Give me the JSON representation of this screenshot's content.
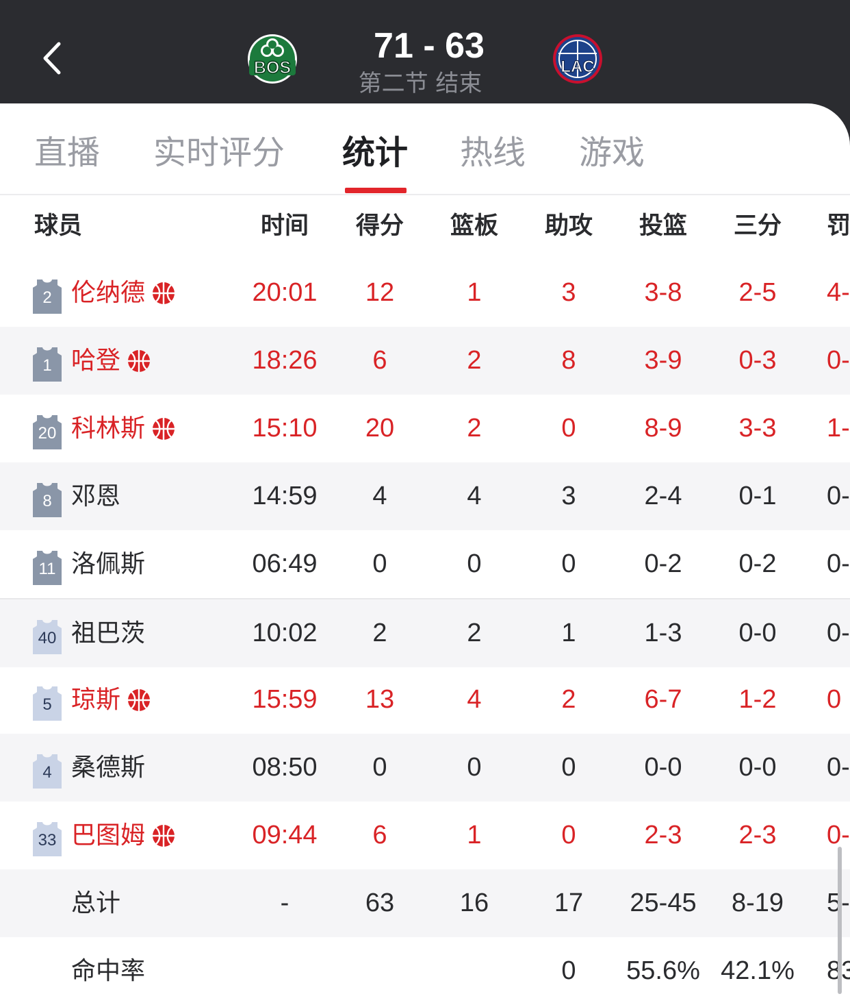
{
  "header": {
    "back_icon": "chevron-left-icon",
    "score": "71 - 63",
    "period": "第二节 结束",
    "home_team": {
      "abbr": "BOS",
      "logo": "bos-logo"
    },
    "away_team": {
      "abbr": "LAC",
      "logo": "lac-logo"
    }
  },
  "tabs": [
    {
      "label": "直播",
      "active": false
    },
    {
      "label": "实时评分",
      "active": false
    },
    {
      "label": "统计",
      "active": true
    },
    {
      "label": "热线",
      "active": false
    },
    {
      "label": "游戏",
      "active": false
    }
  ],
  "table": {
    "columns": [
      "球员",
      "时间",
      "得分",
      "篮板",
      "助攻",
      "投篮",
      "三分",
      "罚"
    ],
    "rows": [
      {
        "number": "2",
        "name": "伦纳德",
        "highlight": true,
        "jersey_style": "dark",
        "cells": [
          "20:01",
          "12",
          "1",
          "3",
          "3-8",
          "2-5",
          "4-"
        ]
      },
      {
        "number": "1",
        "name": "哈登",
        "highlight": true,
        "jersey_style": "dark",
        "cells": [
          "18:26",
          "6",
          "2",
          "8",
          "3-9",
          "0-3",
          "0-"
        ]
      },
      {
        "number": "20",
        "name": "科林斯",
        "highlight": true,
        "jersey_style": "dark",
        "cells": [
          "15:10",
          "20",
          "2",
          "0",
          "8-9",
          "3-3",
          "1-"
        ]
      },
      {
        "number": "8",
        "name": "邓恩",
        "highlight": false,
        "jersey_style": "dark",
        "cells": [
          "14:59",
          "4",
          "4",
          "3",
          "2-4",
          "0-1",
          "0-"
        ]
      },
      {
        "number": "11",
        "name": "洛佩斯",
        "highlight": false,
        "jersey_style": "dark",
        "cells": [
          "06:49",
          "0",
          "0",
          "0",
          "0-2",
          "0-2",
          "0-"
        ]
      },
      {
        "number": "40",
        "name": "祖巴茨",
        "highlight": false,
        "jersey_style": "light",
        "cells": [
          "10:02",
          "2",
          "2",
          "1",
          "1-3",
          "0-0",
          "0-"
        ]
      },
      {
        "number": "5",
        "name": "琼斯",
        "highlight": true,
        "jersey_style": "light",
        "cells": [
          "15:59",
          "13",
          "4",
          "2",
          "6-7",
          "1-2",
          "0"
        ]
      },
      {
        "number": "4",
        "name": "桑德斯",
        "highlight": false,
        "jersey_style": "light",
        "cells": [
          "08:50",
          "0",
          "0",
          "0",
          "0-0",
          "0-0",
          "0-"
        ]
      },
      {
        "number": "33",
        "name": "巴图姆",
        "highlight": true,
        "jersey_style": "light",
        "cells": [
          "09:44",
          "6",
          "1",
          "0",
          "2-3",
          "2-3",
          "0-"
        ]
      }
    ],
    "total": {
      "label": "总计",
      "cells": [
        "-",
        "63",
        "16",
        "17",
        "25-45",
        "8-19",
        "5-"
      ]
    },
    "pct": {
      "label": "命中率",
      "cells": [
        "",
        "",
        "",
        "0",
        "55.6%",
        "42.1%",
        "83."
      ]
    }
  },
  "colors": {
    "header_bg": "#2b2c30",
    "accent_red": "#d92326",
    "jersey_dark": "#8a96a8",
    "jersey_light": "#c9d3e6"
  },
  "icons": {
    "star_player": "basketball-icon",
    "jersey": "jersey-icon"
  }
}
